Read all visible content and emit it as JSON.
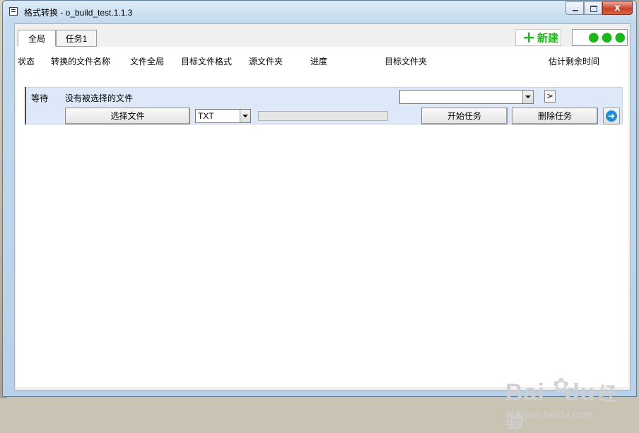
{
  "window": {
    "title": "格式转换 - o_build_test.1.1.3",
    "close_symbol": "x"
  },
  "tabs": [
    {
      "label": "全局"
    },
    {
      "label": "任务1"
    }
  ],
  "toolbar": {
    "new_label": "新建",
    "new_icon": "+",
    "more_label": "●●●",
    "accent_color": "#23b523"
  },
  "columns": [
    "状态",
    "转换的文件名称",
    "文件全局",
    "目标文件格式",
    "源文件夹",
    "进度",
    "目标文件夹",
    "估计剩余时间"
  ],
  "task": {
    "status": "等待",
    "filename": "没有被选择的文件",
    "select_file_label": "选择文件",
    "format_value": "TXT",
    "progress": 0,
    "target_folder_value": "",
    "browse_label": ">",
    "start_label": "开始任务",
    "delete_label": "删除任务",
    "go_icon": "➜"
  },
  "watermark": {
    "brand": "Bai",
    "brand2": "du",
    "site_cn": "经验",
    "url": "jingyan.baidu.com"
  }
}
